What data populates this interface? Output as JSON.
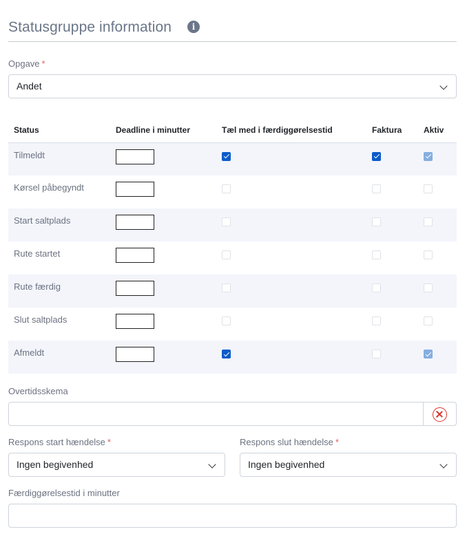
{
  "section": {
    "title": "Statusgruppe information",
    "info_icon": "info-icon"
  },
  "opgave": {
    "label": "Opgave",
    "required_mark": "*",
    "value": "Andet"
  },
  "status_table": {
    "headers": [
      "Status",
      "Deadline i minutter",
      "Tæl med i færdiggørelsestid",
      "Faktura",
      "Aktiv"
    ],
    "rows": [
      {
        "status": "Tilmeldt",
        "deadline": "",
        "count_completion": true,
        "faktura": true,
        "aktiv": true,
        "aktiv_disabled": true
      },
      {
        "status": "Kørsel påbegyndt",
        "deadline": "",
        "count_completion": false,
        "faktura": false,
        "aktiv": false
      },
      {
        "status": "Start saltplads",
        "deadline": "",
        "count_completion": false,
        "faktura": false,
        "aktiv": false
      },
      {
        "status": "Rute startet",
        "deadline": "",
        "count_completion": false,
        "faktura": false,
        "aktiv": false
      },
      {
        "status": "Rute færdig",
        "deadline": "",
        "count_completion": false,
        "faktura": false,
        "aktiv": false
      },
      {
        "status": "Slut saltplads",
        "deadline": "",
        "count_completion": false,
        "faktura": false,
        "aktiv": false
      },
      {
        "status": "Afmeldt",
        "deadline": "",
        "count_completion": true,
        "faktura": false,
        "aktiv": true,
        "aktiv_disabled": true
      }
    ]
  },
  "overtid": {
    "label": "Overtidsskema",
    "value": "",
    "clear_icon": "clear-circle-x-icon"
  },
  "respons_start": {
    "label": "Respons start hændelse",
    "required_mark": "*",
    "value": "Ingen begivenhed"
  },
  "respons_slut": {
    "label": "Respons slut hændelse",
    "required_mark": "*",
    "value": "Ingen begivenhed"
  },
  "completion_time": {
    "label": "Færdiggørelsestid i minutter",
    "value": ""
  },
  "colors": {
    "accent": "#0b5cc9",
    "row_stripe": "#f3f5fb",
    "required": "#e0645c",
    "clear": "#d9342b"
  }
}
